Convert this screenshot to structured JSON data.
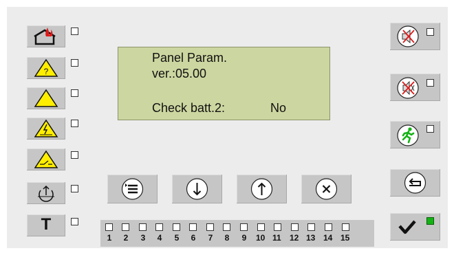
{
  "lcd": {
    "line1": "Panel Param.",
    "line2": "ver.:05.00",
    "line3_label": "Check batt.2:",
    "line3_value": "No"
  },
  "left_buttons": [
    {
      "name": "fire-alarm",
      "icon": "house-fire-icon"
    },
    {
      "name": "unknown-warning",
      "icon": "question-warning-icon"
    },
    {
      "name": "general-fault",
      "icon": "warning-triangle-icon"
    },
    {
      "name": "power-fault",
      "icon": "electrical-warning-icon"
    },
    {
      "name": "line-fault",
      "icon": "line-warning-icon"
    },
    {
      "name": "disable",
      "icon": "power-disable-icon"
    },
    {
      "name": "test",
      "icon": "test-t-icon",
      "label": "T"
    }
  ],
  "right_buttons": [
    {
      "name": "mute-sounder",
      "icon": "speaker-off-icon"
    },
    {
      "name": "mute-buzzer",
      "icon": "speaker-muted-icon"
    },
    {
      "name": "evacuate",
      "icon": "running-man-icon"
    },
    {
      "name": "reset",
      "icon": "enter-return-icon"
    },
    {
      "name": "confirm",
      "icon": "checkmark-icon",
      "led": "green"
    }
  ],
  "nav_buttons": [
    {
      "name": "menu",
      "icon": "menu-list-icon"
    },
    {
      "name": "down",
      "icon": "arrow-down-icon"
    },
    {
      "name": "up",
      "icon": "arrow-up-icon"
    },
    {
      "name": "cancel",
      "icon": "close-x-icon"
    }
  ],
  "zones": [
    "1",
    "2",
    "3",
    "4",
    "5",
    "6",
    "7",
    "8",
    "9",
    "10",
    "11",
    "12",
    "13",
    "14",
    "15"
  ],
  "colors": {
    "panel_bg": "#ececec",
    "button_bg": "#c6c6c6",
    "lcd_bg": "#ccd6a0",
    "warning_yellow": "#ffee00",
    "alert_red": "#e01818",
    "ok_green": "#14b314"
  }
}
